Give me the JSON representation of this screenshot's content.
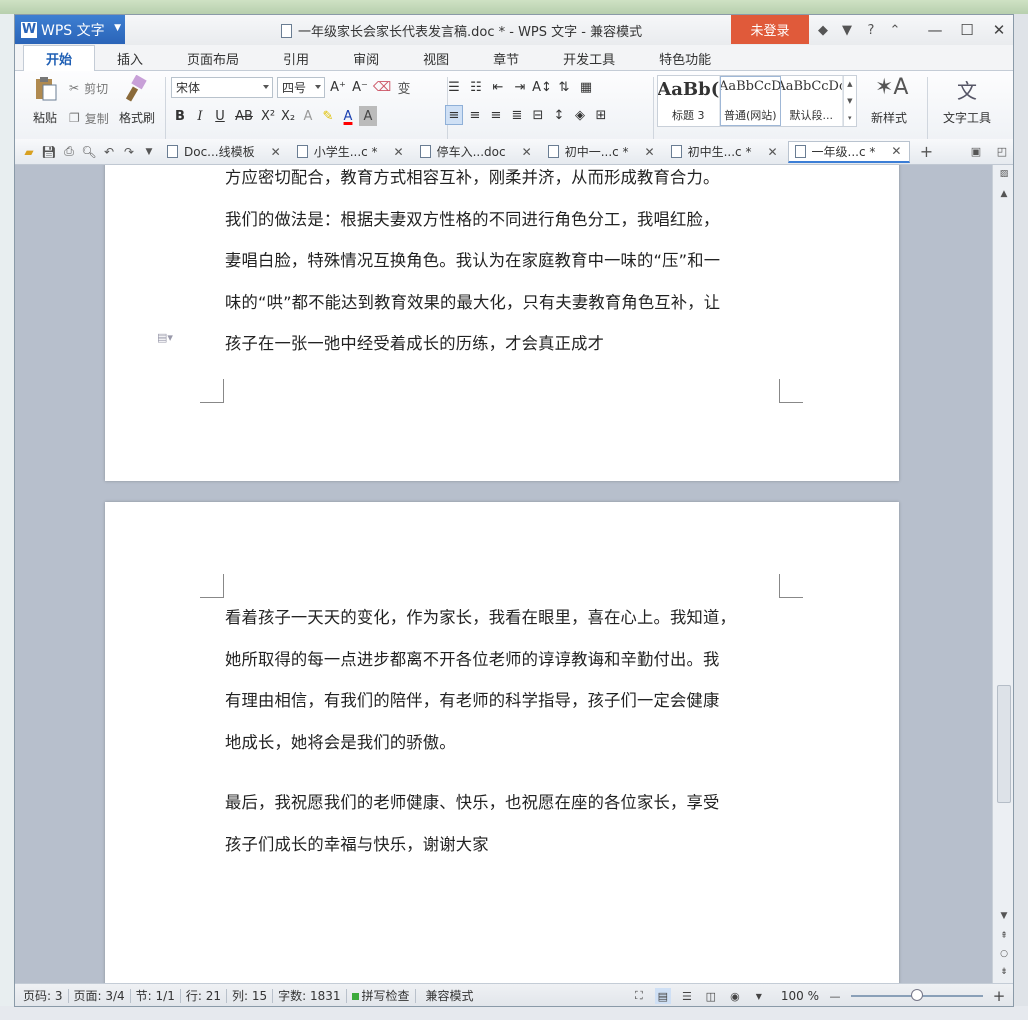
{
  "app": {
    "button_label": "WPS 文字",
    "window_title": "一年级家长会家长代表发言稿.doc * - WPS 文字 - 兼容模式",
    "login_label": "未登录"
  },
  "tabs": [
    "开始",
    "插入",
    "页面布局",
    "引用",
    "审阅",
    "视图",
    "章节",
    "开发工具",
    "特色功能"
  ],
  "ribbon": {
    "paste": "粘贴",
    "cut": "剪切",
    "copy": "复制",
    "format_painter": "格式刷",
    "font_name": "宋体",
    "font_size": "四号",
    "styles": [
      {
        "preview": "AaBb(",
        "label": "标题 3"
      },
      {
        "preview": "AaBbCcD",
        "label": "普通(网站)"
      },
      {
        "preview": "AaBbCcDc",
        "label": "默认段..."
      }
    ],
    "new_style": "新样式",
    "text_tools": "文字工具"
  },
  "doc_tabs": [
    {
      "label": "Doc...线模板",
      "active": false
    },
    {
      "label": "小学生...c *",
      "active": false
    },
    {
      "label": "停车入...doc",
      "active": false
    },
    {
      "label": "初中一...c *",
      "active": false
    },
    {
      "label": "初中生...c *",
      "active": false
    },
    {
      "label": "一年级...c *",
      "active": true
    }
  ],
  "page1": {
    "lines": [
      "方应密切配合，教育方式相容互补，刚柔并济，从而形成教育合力。",
      "我们的做法是：根据夫妻双方性格的不同进行角色分工，我唱红脸，",
      "妻唱白脸，特殊情况互换角色。我认为在家庭教育中一味的“压”和一",
      "味的“哄”都不能达到教育效果的最大化，只有夫妻教育角色互补，让",
      "孩子在一张一弛中经受着成长的历练，才会真正成才"
    ]
  },
  "page2": {
    "para1": [
      "看着孩子一天天的变化，作为家长，我看在眼里，喜在心上。我知道，",
      "她所取得的每一点进步都离不开各位老师的谆谆教诲和辛勤付出。我",
      "有理由相信，有我们的陪伴，有老师的科学指导，孩子们一定会健康",
      "地成长，她将会是我们的骄傲。"
    ],
    "para2": [
      "最后，我祝愿我们的老师健康、快乐，也祝愿在座的各位家长，享受",
      "孩子们成长的幸福与快乐，谢谢大家"
    ]
  },
  "status": {
    "page_code": "页码: 3",
    "page": "页面: 3/4",
    "section": "节: 1/1",
    "row": "行: 21",
    "col": "列: 15",
    "word_count": "字数: 1831",
    "spellcheck": "拼写检查",
    "mode": "兼容模式",
    "zoom": "100 %",
    "zoom_fraction": 0.5
  }
}
